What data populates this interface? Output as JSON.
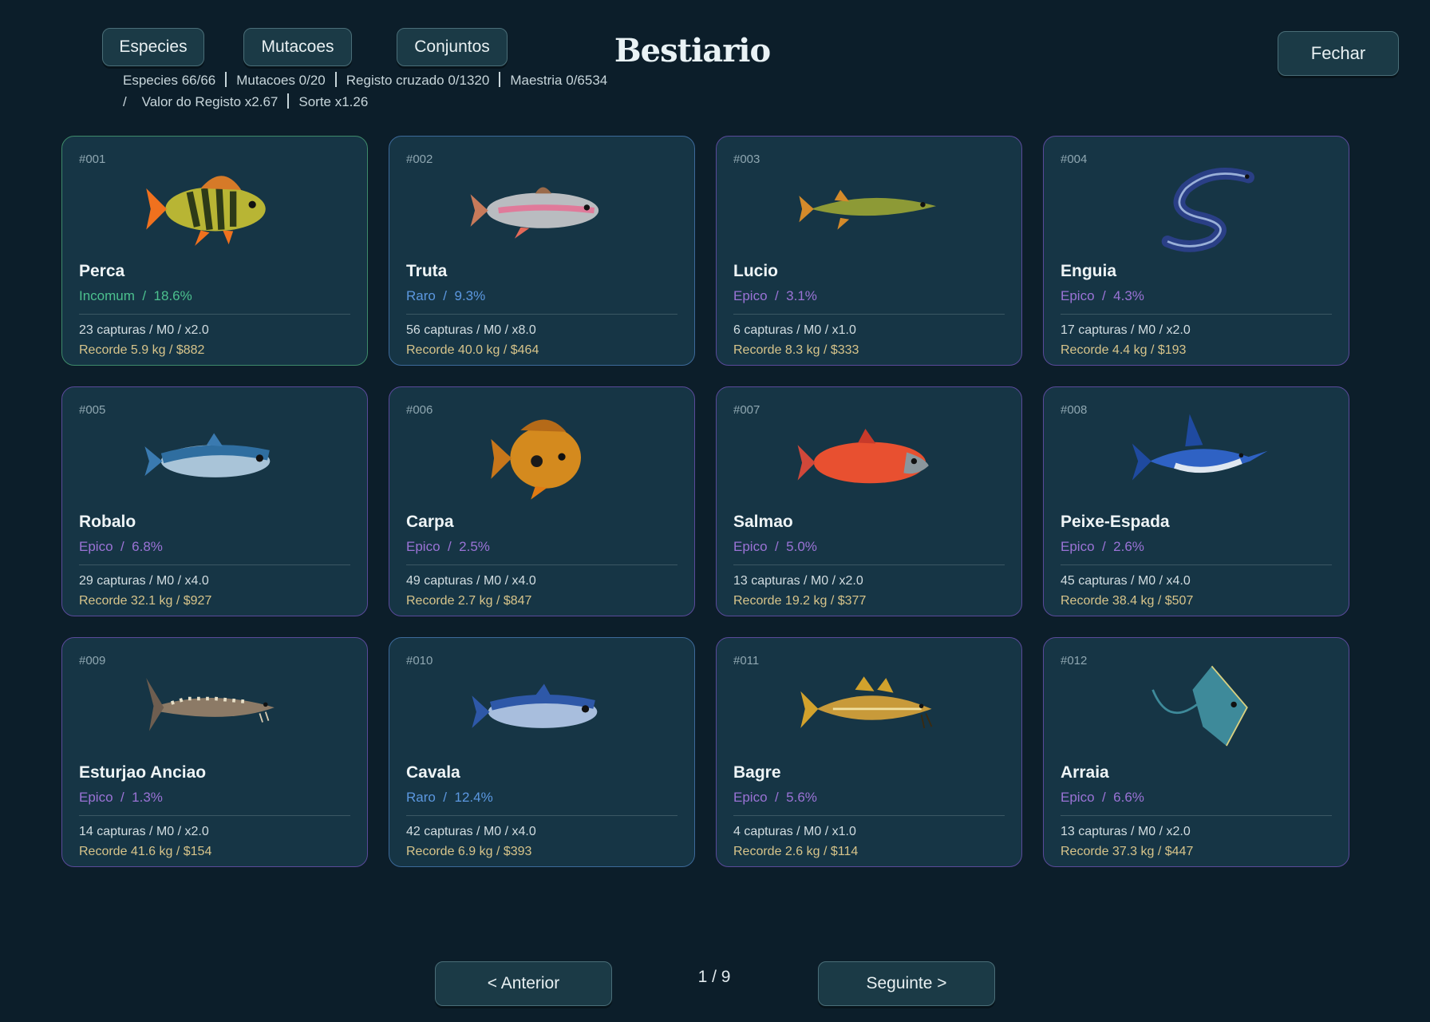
{
  "tabs": [
    "Especies",
    "Mutacoes",
    "Conjuntos"
  ],
  "title": "Bestiario",
  "close_label": "Fechar",
  "stats": {
    "especies": "Especies 66/66",
    "mutacoes": "Mutacoes 0/20",
    "registo": "Registo cruzado 0/1320",
    "maestria": "Maestria 0/6534",
    "lead": "/",
    "valor": "Valor do Registo x2.67",
    "sorte": "Sorte x1.26"
  },
  "cards": [
    {
      "num": "#001",
      "name": "Perca",
      "rarity": "Incomum",
      "pct": "18.6%",
      "line1": "23 capturas  /  M0  /  x2.0",
      "line2": "Recorde 5.9 kg  /  $882",
      "icon": "perch-icon"
    },
    {
      "num": "#002",
      "name": "Truta",
      "rarity": "Raro",
      "pct": "9.3%",
      "line1": "56 capturas  /  M0  /  x8.0",
      "line2": "Recorde 40.0 kg  /  $464",
      "icon": "trout-icon"
    },
    {
      "num": "#003",
      "name": "Lucio",
      "rarity": "Epico",
      "pct": "3.1%",
      "line1": "6 capturas  /  M0  /  x1.0",
      "line2": "Recorde 8.3 kg  /  $333",
      "icon": "pike-icon"
    },
    {
      "num": "#004",
      "name": "Enguia",
      "rarity": "Epico",
      "pct": "4.3%",
      "line1": "17 capturas  /  M0  /  x2.0",
      "line2": "Recorde 4.4 kg  /  $193",
      "icon": "eel-icon"
    },
    {
      "num": "#005",
      "name": "Robalo",
      "rarity": "Epico",
      "pct": "6.8%",
      "line1": "29 capturas  /  M0  /  x4.0",
      "line2": "Recorde 32.1 kg  /  $927",
      "icon": "seabass-icon"
    },
    {
      "num": "#006",
      "name": "Carpa",
      "rarity": "Epico",
      "pct": "2.5%",
      "line1": "49 capturas  /  M0  /  x4.0",
      "line2": "Recorde 2.7 kg  /  $847",
      "icon": "carp-icon"
    },
    {
      "num": "#007",
      "name": "Salmao",
      "rarity": "Epico",
      "pct": "5.0%",
      "line1": "13 capturas  /  M0  /  x2.0",
      "line2": "Recorde 19.2 kg  /  $377",
      "icon": "salmon-icon"
    },
    {
      "num": "#008",
      "name": "Peixe-Espada",
      "rarity": "Epico",
      "pct": "2.6%",
      "line1": "45 capturas  /  M0  /  x4.0",
      "line2": "Recorde 38.4 kg  /  $507",
      "icon": "swordfish-icon"
    },
    {
      "num": "#009",
      "name": "Esturjao Anciao",
      "rarity": "Epico",
      "pct": "1.3%",
      "line1": "14 capturas  /  M0  /  x2.0",
      "line2": "Recorde 41.6 kg  /  $154",
      "icon": "sturgeon-icon"
    },
    {
      "num": "#010",
      "name": "Cavala",
      "rarity": "Raro",
      "pct": "12.4%",
      "line1": "42 capturas  /  M0  /  x4.0",
      "line2": "Recorde 6.9 kg  /  $393",
      "icon": "mackerel-icon"
    },
    {
      "num": "#011",
      "name": "Bagre",
      "rarity": "Epico",
      "pct": "5.6%",
      "line1": "4 capturas  /  M0  /  x1.0",
      "line2": "Recorde 2.6 kg  /  $114",
      "icon": "catfish-icon"
    },
    {
      "num": "#012",
      "name": "Arraia",
      "rarity": "Epico",
      "pct": "6.6%",
      "line1": "13 capturas  /  M0  /  x2.0",
      "line2": "Recorde 37.3 kg  /  $447",
      "icon": "stingray-icon"
    }
  ],
  "pagination": {
    "prev": "< Anterior",
    "next": "Seguinte >",
    "page": "1 / 9"
  }
}
